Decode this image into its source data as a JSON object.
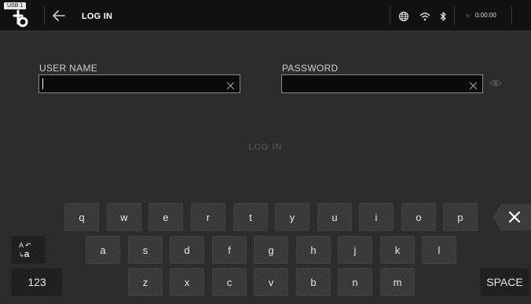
{
  "header": {
    "usb_badge": "USB 1",
    "title": "LOG IN",
    "clock": "0:00:00"
  },
  "form": {
    "username_label": "USER NAME",
    "username_value": "",
    "password_label": "PASSWORD",
    "password_value": "",
    "login_button": "LOG IN"
  },
  "keyboard": {
    "row1": [
      "q",
      "w",
      "e",
      "r",
      "t",
      "y",
      "u",
      "i",
      "o",
      "p"
    ],
    "row2": [
      "a",
      "s",
      "d",
      "f",
      "g",
      "h",
      "j",
      "k",
      "l"
    ],
    "row3": [
      "z",
      "x",
      "c",
      "v",
      "b",
      "n",
      "m"
    ],
    "shift_top": "A",
    "shift_bottom": "a",
    "numbers_key": "123",
    "space_key": "SPACE"
  },
  "icons": {
    "logo": "bluesound-logo-icon",
    "back": "back-arrow-icon",
    "globe": "globe-icon",
    "wifi": "wifi-icon",
    "bluetooth": "bluetooth-icon",
    "clear": "clear-x-icon",
    "eye": "eye-icon",
    "backspace": "backspace-icon"
  },
  "colors": {
    "background": "#2c2c2c",
    "topbar": "#111111",
    "field_bg": "#0a0a0a",
    "field_border": "#8a8a8a",
    "key_bg": "#3a3a3a",
    "login_disabled_text": "#5d5d5d"
  }
}
